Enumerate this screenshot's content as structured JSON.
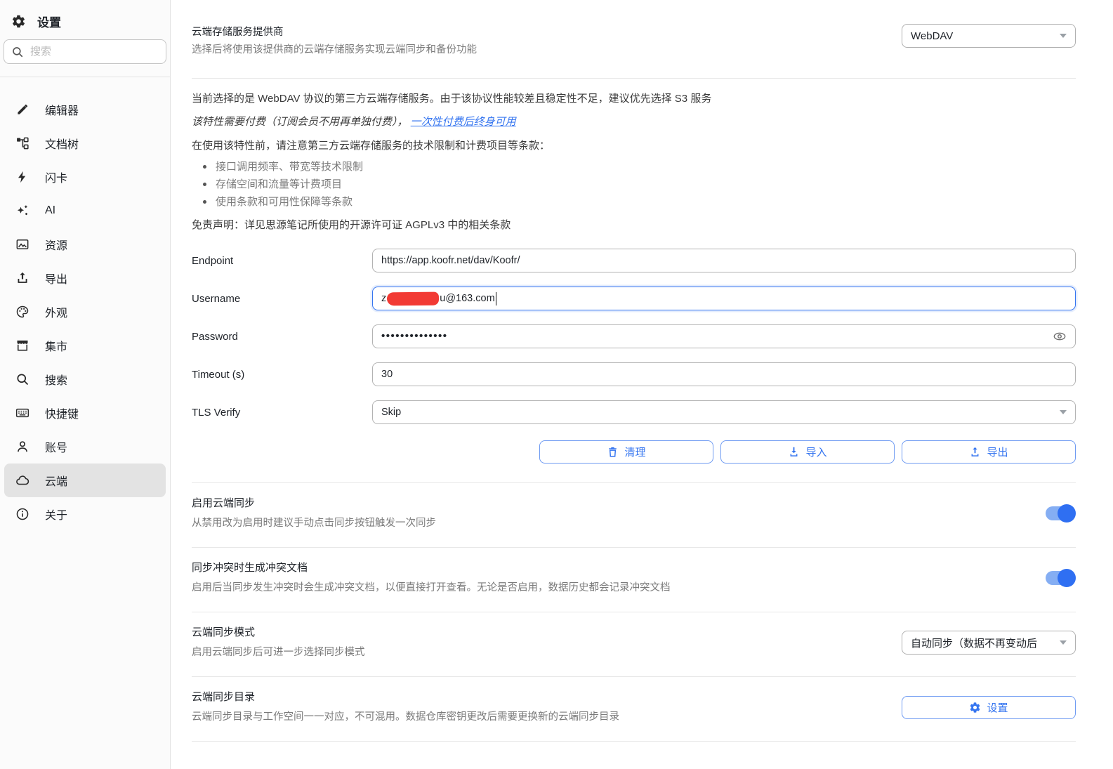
{
  "sidebar": {
    "title": "设置",
    "search_placeholder": "搜索",
    "items": [
      {
        "label": "编辑器",
        "icon": "pencil-icon"
      },
      {
        "label": "文档树",
        "icon": "doc-tree-icon"
      },
      {
        "label": "闪卡",
        "icon": "lightning-icon"
      },
      {
        "label": "AI",
        "icon": "sparkles-icon"
      },
      {
        "label": "资源",
        "icon": "image-icon"
      },
      {
        "label": "导出",
        "icon": "export-icon"
      },
      {
        "label": "外观",
        "icon": "palette-icon"
      },
      {
        "label": "集市",
        "icon": "store-icon"
      },
      {
        "label": "搜索",
        "icon": "search-icon"
      },
      {
        "label": "快捷键",
        "icon": "keyboard-icon"
      },
      {
        "label": "账号",
        "icon": "account-icon"
      },
      {
        "label": "云端",
        "icon": "cloud-icon",
        "selected": true
      },
      {
        "label": "关于",
        "icon": "info-icon"
      }
    ]
  },
  "provider": {
    "title": "云端存储服务提供商",
    "description": "选择后将使用该提供商的云端存储服务实现云端同步和备份功能",
    "selected_option": "WebDAV"
  },
  "notice": {
    "line1": "当前选择的是 WebDAV 协议的第三方云端存储服务。由于该协议性能较差且稳定性不足，建议优先选择 S3 服务",
    "line2_prefix": "该特性需要付费（订阅会员不用再单独付费）， ",
    "line2_link": "一次性付费后终身可用",
    "line3": "在使用该特性前，请注意第三方云端存储服务的技术限制和计费项目等条款：",
    "bullets": [
      "接口调用频率、带宽等技术限制",
      "存储空间和流量等计费项目",
      "使用条款和可用性保障等条款"
    ],
    "disclaimer": "免责声明：详见思源笔记所使用的开源许可证 AGPLv3 中的相关条款"
  },
  "form": {
    "endpoint_label": "Endpoint",
    "endpoint_value": "https://app.koofr.net/dav/Koofr/",
    "username_label": "Username",
    "username_prefix": "z",
    "username_suffix": "u@163.com",
    "password_label": "Password",
    "password_value": "••••••••••••••",
    "timeout_label": "Timeout (s)",
    "timeout_value": "30",
    "tls_label": "TLS Verify",
    "tls_value": "Skip"
  },
  "actions": {
    "clean_label": "清理",
    "import_label": "导入",
    "export_label": "导出"
  },
  "settings_rows": [
    {
      "title": "启用云端同步",
      "description": "从禁用改为启用时建议手动点击同步按钮触发一次同步",
      "control": "toggle",
      "state": "on"
    },
    {
      "title": "同步冲突时生成冲突文档",
      "description": "启用后当同步发生冲突时会生成冲突文档，以便直接打开查看。无论是否启用，数据历史都会记录冲突文档",
      "control": "toggle",
      "state": "on"
    },
    {
      "title": "云端同步模式",
      "description": "启用云端同步后可进一步选择同步模式",
      "control": "select",
      "value": "自动同步（数据不再变动后"
    },
    {
      "title": "云端同步目录",
      "description": "云端同步目录与工作空间一一对应，不可混用。数据仓库密钥更改后需要更换新的云端同步目录",
      "control": "button",
      "value": "设置"
    }
  ],
  "colors": {
    "accent": "#3575f0",
    "toggle_track": "#85aef3",
    "toggle_knob": "#2f6ff2",
    "redaction": "#f23a34",
    "selected_item_bg": "#e3e3e3"
  }
}
